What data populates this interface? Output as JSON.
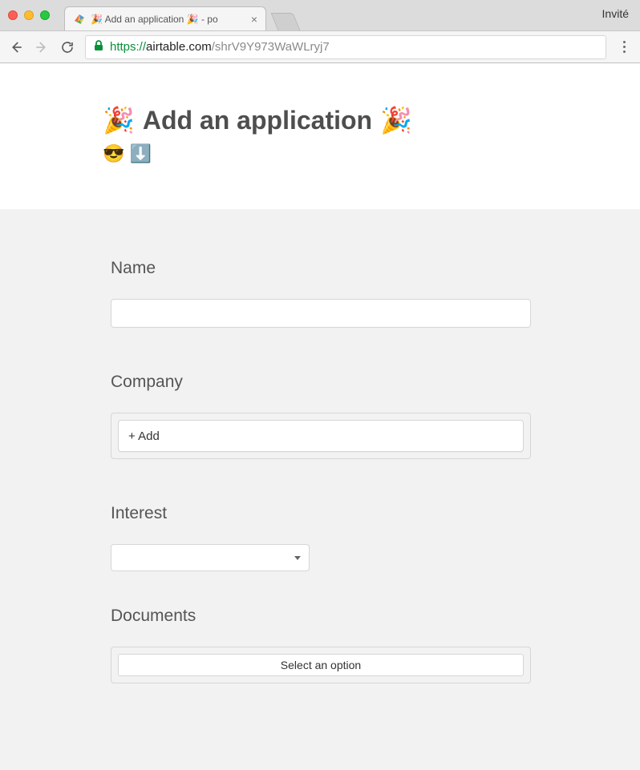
{
  "browser": {
    "guest_label": "Invité",
    "tab": {
      "title": "🎉 Add an application 🎉 - po"
    },
    "url": {
      "scheme": "https://",
      "host": "airtable.com",
      "path": "/shrV9Y973WaWLryj7"
    }
  },
  "header": {
    "title_prefix_emoji": "🎉",
    "title_text": "Add an application",
    "title_suffix_emoji": "🎉",
    "subtitle": "😎 ⬇️"
  },
  "form": {
    "name": {
      "label": "Name",
      "value": ""
    },
    "company": {
      "label": "Company",
      "add_button": "+ Add"
    },
    "interest": {
      "label": "Interest",
      "value": ""
    },
    "documents": {
      "label": "Documents",
      "select_placeholder": "Select an option"
    }
  }
}
